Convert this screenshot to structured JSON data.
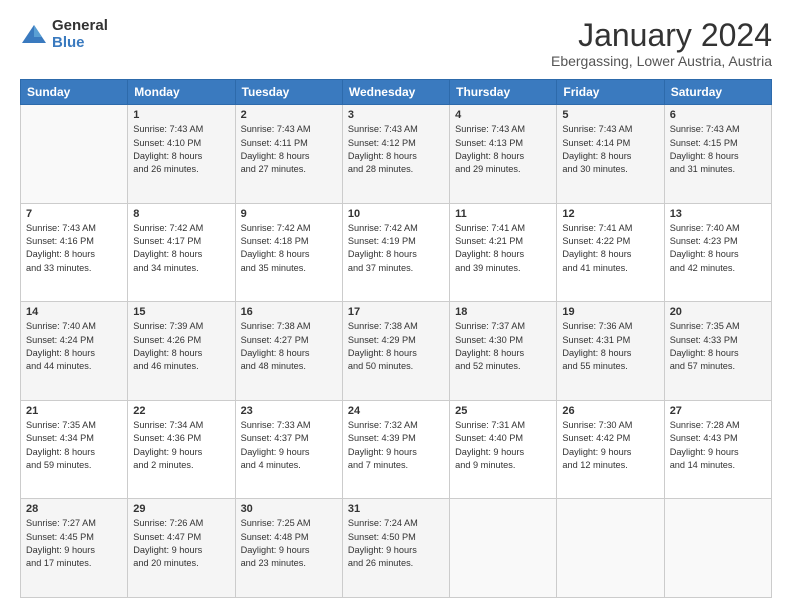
{
  "logo": {
    "general": "General",
    "blue": "Blue"
  },
  "title": "January 2024",
  "subtitle": "Ebergassing, Lower Austria, Austria",
  "headers": [
    "Sunday",
    "Monday",
    "Tuesday",
    "Wednesday",
    "Thursday",
    "Friday",
    "Saturday"
  ],
  "weeks": [
    [
      {
        "day": "",
        "info": ""
      },
      {
        "day": "1",
        "info": "Sunrise: 7:43 AM\nSunset: 4:10 PM\nDaylight: 8 hours\nand 26 minutes."
      },
      {
        "day": "2",
        "info": "Sunrise: 7:43 AM\nSunset: 4:11 PM\nDaylight: 8 hours\nand 27 minutes."
      },
      {
        "day": "3",
        "info": "Sunrise: 7:43 AM\nSunset: 4:12 PM\nDaylight: 8 hours\nand 28 minutes."
      },
      {
        "day": "4",
        "info": "Sunrise: 7:43 AM\nSunset: 4:13 PM\nDaylight: 8 hours\nand 29 minutes."
      },
      {
        "day": "5",
        "info": "Sunrise: 7:43 AM\nSunset: 4:14 PM\nDaylight: 8 hours\nand 30 minutes."
      },
      {
        "day": "6",
        "info": "Sunrise: 7:43 AM\nSunset: 4:15 PM\nDaylight: 8 hours\nand 31 minutes."
      }
    ],
    [
      {
        "day": "7",
        "info": "Sunrise: 7:43 AM\nSunset: 4:16 PM\nDaylight: 8 hours\nand 33 minutes."
      },
      {
        "day": "8",
        "info": "Sunrise: 7:42 AM\nSunset: 4:17 PM\nDaylight: 8 hours\nand 34 minutes."
      },
      {
        "day": "9",
        "info": "Sunrise: 7:42 AM\nSunset: 4:18 PM\nDaylight: 8 hours\nand 35 minutes."
      },
      {
        "day": "10",
        "info": "Sunrise: 7:42 AM\nSunset: 4:19 PM\nDaylight: 8 hours\nand 37 minutes."
      },
      {
        "day": "11",
        "info": "Sunrise: 7:41 AM\nSunset: 4:21 PM\nDaylight: 8 hours\nand 39 minutes."
      },
      {
        "day": "12",
        "info": "Sunrise: 7:41 AM\nSunset: 4:22 PM\nDaylight: 8 hours\nand 41 minutes."
      },
      {
        "day": "13",
        "info": "Sunrise: 7:40 AM\nSunset: 4:23 PM\nDaylight: 8 hours\nand 42 minutes."
      }
    ],
    [
      {
        "day": "14",
        "info": "Sunrise: 7:40 AM\nSunset: 4:24 PM\nDaylight: 8 hours\nand 44 minutes."
      },
      {
        "day": "15",
        "info": "Sunrise: 7:39 AM\nSunset: 4:26 PM\nDaylight: 8 hours\nand 46 minutes."
      },
      {
        "day": "16",
        "info": "Sunrise: 7:38 AM\nSunset: 4:27 PM\nDaylight: 8 hours\nand 48 minutes."
      },
      {
        "day": "17",
        "info": "Sunrise: 7:38 AM\nSunset: 4:29 PM\nDaylight: 8 hours\nand 50 minutes."
      },
      {
        "day": "18",
        "info": "Sunrise: 7:37 AM\nSunset: 4:30 PM\nDaylight: 8 hours\nand 52 minutes."
      },
      {
        "day": "19",
        "info": "Sunrise: 7:36 AM\nSunset: 4:31 PM\nDaylight: 8 hours\nand 55 minutes."
      },
      {
        "day": "20",
        "info": "Sunrise: 7:35 AM\nSunset: 4:33 PM\nDaylight: 8 hours\nand 57 minutes."
      }
    ],
    [
      {
        "day": "21",
        "info": "Sunrise: 7:35 AM\nSunset: 4:34 PM\nDaylight: 8 hours\nand 59 minutes."
      },
      {
        "day": "22",
        "info": "Sunrise: 7:34 AM\nSunset: 4:36 PM\nDaylight: 9 hours\nand 2 minutes."
      },
      {
        "day": "23",
        "info": "Sunrise: 7:33 AM\nSunset: 4:37 PM\nDaylight: 9 hours\nand 4 minutes."
      },
      {
        "day": "24",
        "info": "Sunrise: 7:32 AM\nSunset: 4:39 PM\nDaylight: 9 hours\nand 7 minutes."
      },
      {
        "day": "25",
        "info": "Sunrise: 7:31 AM\nSunset: 4:40 PM\nDaylight: 9 hours\nand 9 minutes."
      },
      {
        "day": "26",
        "info": "Sunrise: 7:30 AM\nSunset: 4:42 PM\nDaylight: 9 hours\nand 12 minutes."
      },
      {
        "day": "27",
        "info": "Sunrise: 7:28 AM\nSunset: 4:43 PM\nDaylight: 9 hours\nand 14 minutes."
      }
    ],
    [
      {
        "day": "28",
        "info": "Sunrise: 7:27 AM\nSunset: 4:45 PM\nDaylight: 9 hours\nand 17 minutes."
      },
      {
        "day": "29",
        "info": "Sunrise: 7:26 AM\nSunset: 4:47 PM\nDaylight: 9 hours\nand 20 minutes."
      },
      {
        "day": "30",
        "info": "Sunrise: 7:25 AM\nSunset: 4:48 PM\nDaylight: 9 hours\nand 23 minutes."
      },
      {
        "day": "31",
        "info": "Sunrise: 7:24 AM\nSunset: 4:50 PM\nDaylight: 9 hours\nand 26 minutes."
      },
      {
        "day": "",
        "info": ""
      },
      {
        "day": "",
        "info": ""
      },
      {
        "day": "",
        "info": ""
      }
    ]
  ]
}
